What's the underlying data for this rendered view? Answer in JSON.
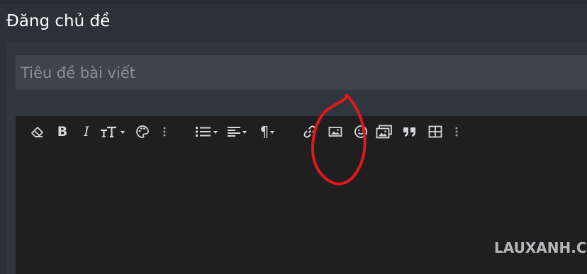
{
  "page": {
    "title": "Đăng chủ đề"
  },
  "form": {
    "title_placeholder": "Tiêu đề bài viết",
    "title_value": ""
  },
  "toolbar": {
    "buttons": [
      {
        "name": "remove-format-button",
        "icon": "eraser-icon"
      },
      {
        "name": "bold-button",
        "icon": "bold-icon",
        "label": "B"
      },
      {
        "name": "italic-button",
        "icon": "italic-icon",
        "label": "I"
      },
      {
        "name": "text-size-button",
        "icon": "text-size-icon"
      },
      {
        "name": "text-color-button",
        "icon": "palette-icon"
      },
      {
        "name": "more-text-options-button",
        "icon": "more-vertical-icon"
      },
      {
        "name": "list-button",
        "icon": "list-icon"
      },
      {
        "name": "align-button",
        "icon": "align-left-icon"
      },
      {
        "name": "paragraph-button",
        "icon": "paragraph-icon",
        "label": "¶"
      },
      {
        "name": "insert-link-button",
        "icon": "link-icon"
      },
      {
        "name": "insert-image-button",
        "icon": "image-icon"
      },
      {
        "name": "insert-smilie-button",
        "icon": "smile-icon"
      },
      {
        "name": "insert-media-button",
        "icon": "media-icon"
      },
      {
        "name": "quote-button",
        "icon": "quote-icon"
      },
      {
        "name": "insert-table-button",
        "icon": "table-icon"
      },
      {
        "name": "more-insert-options-button",
        "icon": "more-vertical-icon"
      }
    ]
  },
  "annotation": {
    "color": "#e0191f",
    "target": "insert-image-button"
  },
  "watermark": {
    "text": "LAUXANH.CC"
  },
  "colors": {
    "background": "#2b3138",
    "input_background": "#3f434c",
    "editor_background": "#201f20",
    "icon": "#d6d8db"
  }
}
